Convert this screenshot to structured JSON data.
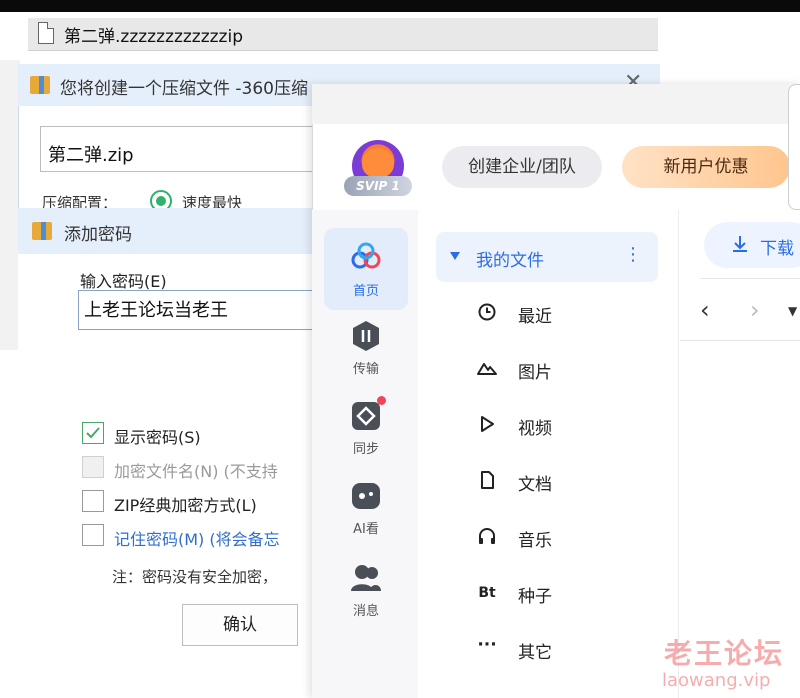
{
  "file_row": {
    "filename": "第二弹.zzzzzzzzzzzzip"
  },
  "compress_window": {
    "title": "您将创建一个压缩文件 -360压缩",
    "close": "✕",
    "archive_name": "第二弹.zip",
    "config_label": "压缩配置：",
    "config_value": "速度最快"
  },
  "password_dialog": {
    "title": "添加密码",
    "input_label": "输入密码(E)",
    "password_value": "上老王论坛当老王",
    "options": [
      {
        "label": "显示密码(S)",
        "checked": true,
        "disabled": false,
        "style": "normal"
      },
      {
        "label": "加密文件名(N) (不支持",
        "checked": false,
        "disabled": true,
        "style": "disabled"
      },
      {
        "label": "ZIP经典加密方式(L)",
        "checked": false,
        "disabled": false,
        "style": "normal"
      },
      {
        "label": "记住密码(M) (将会备忘",
        "checked": false,
        "disabled": false,
        "style": "blue"
      }
    ],
    "note": "注：密码没有安全加密，",
    "ok_label": "确认"
  },
  "netdisk": {
    "vip_badge": "SVIP 1",
    "header_buttons": {
      "team": "创建企业/团队",
      "new_user": "新用户优惠"
    },
    "nav": [
      {
        "label": "首页",
        "icon": "home-cloud-icon",
        "selected": true
      },
      {
        "label": "传输",
        "icon": "transfer-icon",
        "selected": false
      },
      {
        "label": "同步",
        "icon": "sync-icon",
        "selected": false
      },
      {
        "label": "AI看",
        "icon": "ai-watch-icon",
        "selected": false
      },
      {
        "label": "消息",
        "icon": "message-icon",
        "selected": false
      }
    ],
    "tree_title": "我的文件",
    "tree_items": [
      {
        "label": "最近",
        "icon": "clock-icon"
      },
      {
        "label": "图片",
        "icon": "mountain-icon"
      },
      {
        "label": "视频",
        "icon": "play-icon"
      },
      {
        "label": "文档",
        "icon": "document-icon"
      },
      {
        "label": "音乐",
        "icon": "headphones-icon"
      },
      {
        "label": "种子",
        "icon": "bt-icon"
      },
      {
        "label": "其它",
        "icon": "ellipsis-icon"
      }
    ],
    "download_label": "下载",
    "bt_glyph": "Bt"
  },
  "watermark": {
    "cn": "老王论坛",
    "url": "laowang.vip"
  },
  "colors": {
    "accent": "#2b6de5",
    "radio_green": "#2fb26a",
    "title_bg": "#e5effb"
  }
}
